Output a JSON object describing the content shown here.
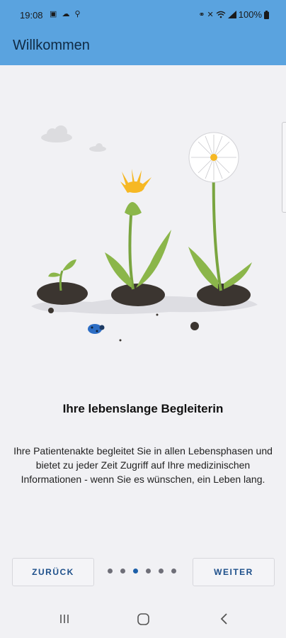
{
  "status_bar": {
    "time": "19:08",
    "battery": "100%",
    "left_icons": [
      "gallery-icon",
      "cloud-icon",
      "location-icon"
    ],
    "right_icons": [
      "link-icon",
      "mute-icon",
      "wifi-icon",
      "signal-icon",
      "battery-icon"
    ]
  },
  "app_bar": {
    "title": "Willkommen"
  },
  "onboarding": {
    "headline": "Ihre lebenslange Begleiterin",
    "body": "Ihre Patientenakte begleitet Sie in allen Lebensphasen und bietet zu jeder Zeit Zugriff auf Ihre medizinischen Informationen - wenn Sie es wünschen, ein Leben lang.",
    "page_count": 6,
    "current_page": 3
  },
  "buttons": {
    "back": "ZURÜCK",
    "next": "WEITER"
  },
  "nav_bar": {
    "items": [
      "recents-icon",
      "home-icon",
      "back-icon"
    ]
  },
  "colors": {
    "app_bar": "#5aa3df",
    "accent": "#1c5fa8",
    "background": "#f1f1f4"
  }
}
